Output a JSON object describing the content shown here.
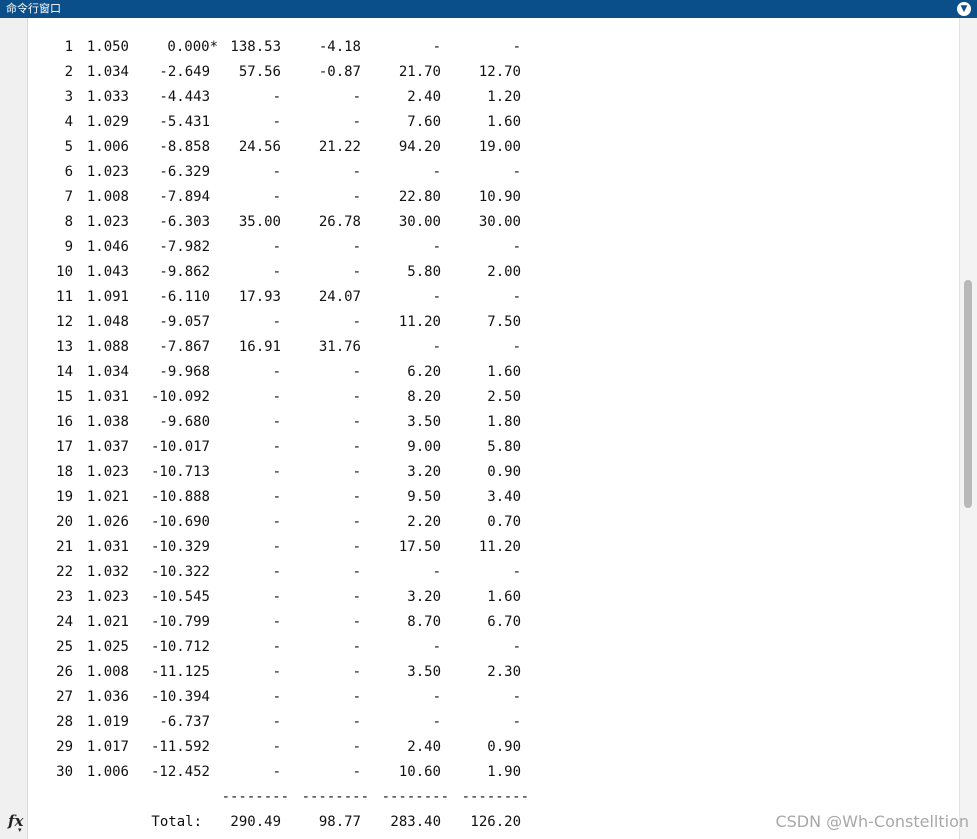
{
  "window": {
    "title": "命令行窗口",
    "menu_icon": "dropdown-icon"
  },
  "rows": [
    {
      "bus": "1",
      "v": "1.050",
      "ang": "0.000*",
      "pg": "138.53",
      "qg": "-4.18",
      "pl": "-",
      "ql": "-"
    },
    {
      "bus": "2",
      "v": "1.034",
      "ang": "-2.649",
      "pg": "57.56",
      "qg": "-0.87",
      "pl": "21.70",
      "ql": "12.70"
    },
    {
      "bus": "3",
      "v": "1.033",
      "ang": "-4.443",
      "pg": "-",
      "qg": "-",
      "pl": "2.40",
      "ql": "1.20"
    },
    {
      "bus": "4",
      "v": "1.029",
      "ang": "-5.431",
      "pg": "-",
      "qg": "-",
      "pl": "7.60",
      "ql": "1.60"
    },
    {
      "bus": "5",
      "v": "1.006",
      "ang": "-8.858",
      "pg": "24.56",
      "qg": "21.22",
      "pl": "94.20",
      "ql": "19.00"
    },
    {
      "bus": "6",
      "v": "1.023",
      "ang": "-6.329",
      "pg": "-",
      "qg": "-",
      "pl": "-",
      "ql": "-"
    },
    {
      "bus": "7",
      "v": "1.008",
      "ang": "-7.894",
      "pg": "-",
      "qg": "-",
      "pl": "22.80",
      "ql": "10.90"
    },
    {
      "bus": "8",
      "v": "1.023",
      "ang": "-6.303",
      "pg": "35.00",
      "qg": "26.78",
      "pl": "30.00",
      "ql": "30.00"
    },
    {
      "bus": "9",
      "v": "1.046",
      "ang": "-7.982",
      "pg": "-",
      "qg": "-",
      "pl": "-",
      "ql": "-"
    },
    {
      "bus": "10",
      "v": "1.043",
      "ang": "-9.862",
      "pg": "-",
      "qg": "-",
      "pl": "5.80",
      "ql": "2.00"
    },
    {
      "bus": "11",
      "v": "1.091",
      "ang": "-6.110",
      "pg": "17.93",
      "qg": "24.07",
      "pl": "-",
      "ql": "-"
    },
    {
      "bus": "12",
      "v": "1.048",
      "ang": "-9.057",
      "pg": "-",
      "qg": "-",
      "pl": "11.20",
      "ql": "7.50"
    },
    {
      "bus": "13",
      "v": "1.088",
      "ang": "-7.867",
      "pg": "16.91",
      "qg": "31.76",
      "pl": "-",
      "ql": "-"
    },
    {
      "bus": "14",
      "v": "1.034",
      "ang": "-9.968",
      "pg": "-",
      "qg": "-",
      "pl": "6.20",
      "ql": "1.60"
    },
    {
      "bus": "15",
      "v": "1.031",
      "ang": "-10.092",
      "pg": "-",
      "qg": "-",
      "pl": "8.20",
      "ql": "2.50"
    },
    {
      "bus": "16",
      "v": "1.038",
      "ang": "-9.680",
      "pg": "-",
      "qg": "-",
      "pl": "3.50",
      "ql": "1.80"
    },
    {
      "bus": "17",
      "v": "1.037",
      "ang": "-10.017",
      "pg": "-",
      "qg": "-",
      "pl": "9.00",
      "ql": "5.80"
    },
    {
      "bus": "18",
      "v": "1.023",
      "ang": "-10.713",
      "pg": "-",
      "qg": "-",
      "pl": "3.20",
      "ql": "0.90"
    },
    {
      "bus": "19",
      "v": "1.021",
      "ang": "-10.888",
      "pg": "-",
      "qg": "-",
      "pl": "9.50",
      "ql": "3.40"
    },
    {
      "bus": "20",
      "v": "1.026",
      "ang": "-10.690",
      "pg": "-",
      "qg": "-",
      "pl": "2.20",
      "ql": "0.70"
    },
    {
      "bus": "21",
      "v": "1.031",
      "ang": "-10.329",
      "pg": "-",
      "qg": "-",
      "pl": "17.50",
      "ql": "11.20"
    },
    {
      "bus": "22",
      "v": "1.032",
      "ang": "-10.322",
      "pg": "-",
      "qg": "-",
      "pl": "-",
      "ql": "-"
    },
    {
      "bus": "23",
      "v": "1.023",
      "ang": "-10.545",
      "pg": "-",
      "qg": "-",
      "pl": "3.20",
      "ql": "1.60"
    },
    {
      "bus": "24",
      "v": "1.021",
      "ang": "-10.799",
      "pg": "-",
      "qg": "-",
      "pl": "8.70",
      "ql": "6.70"
    },
    {
      "bus": "25",
      "v": "1.025",
      "ang": "-10.712",
      "pg": "-",
      "qg": "-",
      "pl": "-",
      "ql": "-"
    },
    {
      "bus": "26",
      "v": "1.008",
      "ang": "-11.125",
      "pg": "-",
      "qg": "-",
      "pl": "3.50",
      "ql": "2.30"
    },
    {
      "bus": "27",
      "v": "1.036",
      "ang": "-10.394",
      "pg": "-",
      "qg": "-",
      "pl": "-",
      "ql": "-"
    },
    {
      "bus": "28",
      "v": "1.019",
      "ang": "-6.737",
      "pg": "-",
      "qg": "-",
      "pl": "-",
      "ql": "-"
    },
    {
      "bus": "29",
      "v": "1.017",
      "ang": "-11.592",
      "pg": "-",
      "qg": "-",
      "pl": "2.40",
      "ql": "0.90"
    },
    {
      "bus": "30",
      "v": "1.006",
      "ang": "-12.452",
      "pg": "-",
      "qg": "-",
      "pl": "10.60",
      "ql": "1.90"
    }
  ],
  "separator": "--------",
  "header_dashes": [
    "-----",
    "-------",
    "--------",
    "--------",
    "--------",
    "--------",
    "--------"
  ],
  "totals": {
    "label": "Total:",
    "pg": "290.49",
    "qg": "98.77",
    "pl": "283.40",
    "ql": "126.20"
  },
  "prompt_icon": "fx-icon",
  "watermark": "CSDN @Wh-Constelltion"
}
